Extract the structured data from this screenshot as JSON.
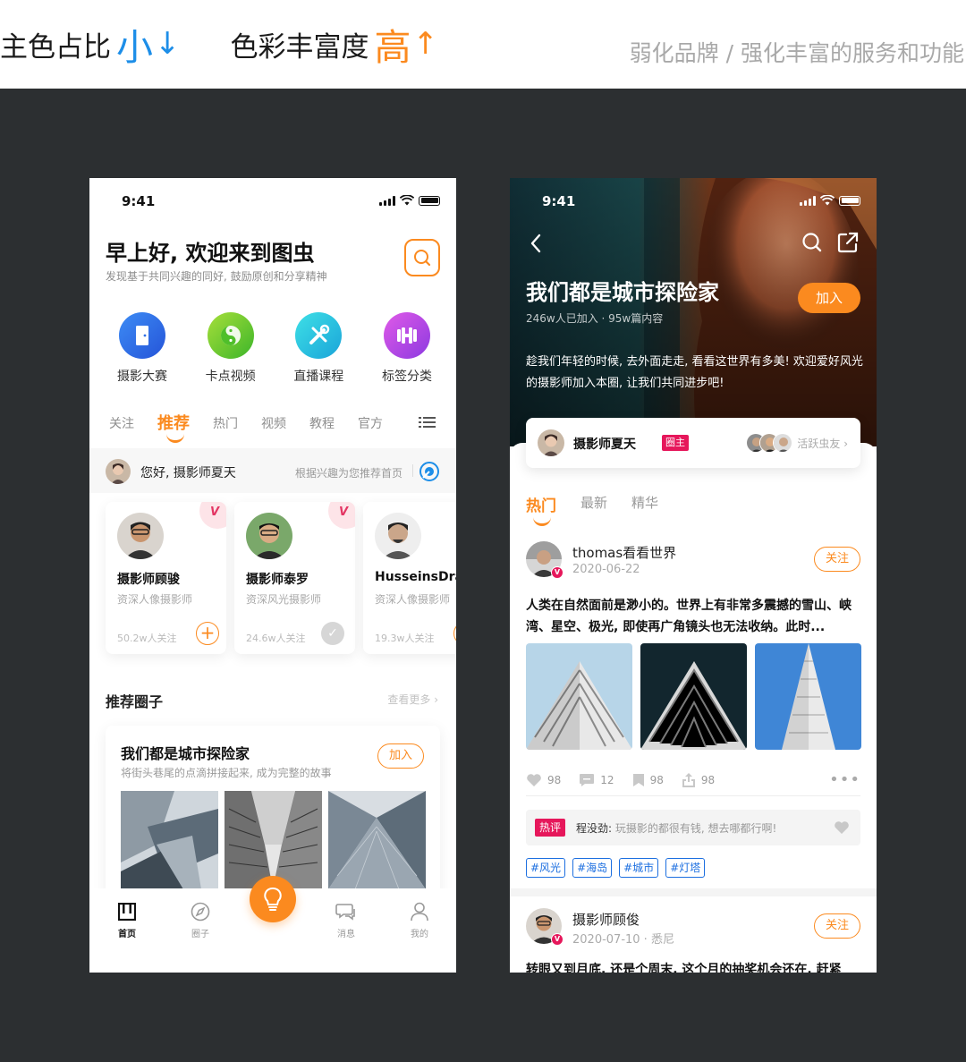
{
  "header": {
    "left1": "主色占比",
    "left1_em": "小",
    "left2": "色彩丰富度",
    "left2_em": "高",
    "right": "弱化品牌 / 强化丰富的服务和功能"
  },
  "colors": {
    "accent": "#fb8a1f",
    "blue": "#1d8ee8",
    "brand_red": "#e6175b",
    "bg_dark": "#2c2f31"
  },
  "phone1": {
    "time": "9:41",
    "greeting": "早上好, 欢迎来到图虫",
    "subtitle": "发现基于共同兴趣的同好, 鼓励原创和分享精神",
    "categories": [
      {
        "label": "摄影大赛",
        "icon": "door-icon",
        "color": "#2f6fe6"
      },
      {
        "label": "卡点视频",
        "icon": "yinyang-icon",
        "color": "#7ccc1e"
      },
      {
        "label": "直播课程",
        "icon": "tools-icon",
        "color": "#1fc2d8"
      },
      {
        "label": "标签分类",
        "icon": "dumbbell-icon",
        "color": "#b44ae6"
      }
    ],
    "tabs": [
      "关注",
      "推荐",
      "热门",
      "视频",
      "教程",
      "官方"
    ],
    "active_tab": "推荐",
    "feed_greeting": "您好, 摄影师夏天",
    "feed_hint": "根据兴趣为您推荐首页",
    "people": [
      {
        "name": "摄影师顾骏",
        "desc": "资深人像摄影师",
        "followers": "50.2w人关注",
        "verified": true,
        "followed": false
      },
      {
        "name": "摄影师泰罗",
        "desc": "资深风光摄影师",
        "followers": "24.6w人关注",
        "verified": true,
        "followed": true
      },
      {
        "name": "HusseinsDrama",
        "desc": "资深人像摄影师",
        "followers": "19.3w人关注",
        "verified": false,
        "followed": false
      }
    ],
    "section_title": "推荐圈子",
    "section_more": "查看更多 ›",
    "circle": {
      "title": "我们都是城市探险家",
      "subtitle": "将街头巷尾的点滴拼接起来, 成为完整的故事",
      "join": "加入"
    },
    "nav": [
      "首页",
      "圈子",
      "",
      "消息",
      "我的"
    ]
  },
  "phone2": {
    "time": "9:41",
    "title": "我们都是城市探险家",
    "stats": "246w人已加入 · 95w篇内容",
    "join": "加入",
    "desc": "趁我们年轻的时候, 去外面走走, 看看这世界有多美! 欢迎爱好风光的摄影师加入本圈, 让我们共同进步吧!",
    "owner_name": "摄影师夏天",
    "owner_tag": "圈主",
    "active_label": "活跃虫友 ›",
    "tabs": [
      "热门",
      "最新",
      "精华"
    ],
    "active_tab": "热门",
    "post1": {
      "name": "thomas看看世界",
      "date": "2020-06-22",
      "follow": "关注",
      "text": "人类在自然面前是渺小的。世界上有非常多震撼的雪山、峡湾、星空、极光, 即使再广角镜头也无法收纳。此时...",
      "likes": "98",
      "comments": "12",
      "saves": "98",
      "shares": "98",
      "hot_label": "热评",
      "comment_user": "程没劲:",
      "comment_text": "玩摄影的都很有钱, 想去哪都行啊!",
      "tags": [
        "#风光",
        "#海岛",
        "#城市",
        "#灯塔"
      ]
    },
    "post2": {
      "name": "摄影师顾俊",
      "date": "2020-07-10 · 悉尼",
      "follow": "关注",
      "text": "转眼又到月底, 还是个周末, 这个月的抽奖机会还在, 赶紧"
    }
  }
}
